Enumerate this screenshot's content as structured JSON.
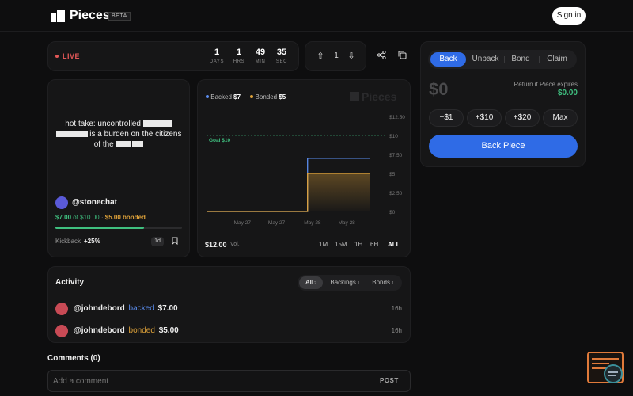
{
  "header": {
    "brand": "Pieces",
    "badge": "BETA",
    "signin_label": "Sign in"
  },
  "status": {
    "live_label": "LIVE",
    "countdown": [
      {
        "value": "1",
        "unit": "DAYS"
      },
      {
        "value": "1",
        "unit": "HRS"
      },
      {
        "value": "49",
        "unit": "MIN"
      },
      {
        "value": "35",
        "unit": "SEC"
      }
    ],
    "vote_count": "1"
  },
  "piece": {
    "text_lines": [
      "hot take: uncontrolled",
      "is a burden on the citizens",
      "of the"
    ],
    "author": "@stonechat",
    "backed": "$7.00",
    "goal_text": "of $10.00",
    "bonded": "$5.00 bonded",
    "progress": 0.7,
    "kickback_label": "Kickback",
    "kickback_value": "+25%",
    "period": "1d"
  },
  "chart_data": {
    "type": "line",
    "legend": [
      {
        "name": "Backed",
        "value": "$7",
        "color": "#5b8def"
      },
      {
        "name": "Bonded",
        "value": "$5",
        "color": "#e0a33a"
      }
    ],
    "x_ticks": [
      "May 27",
      "May 27",
      "May 28",
      "May 28"
    ],
    "y_ticks": [
      "$12.50",
      "$10",
      "$7.50",
      "$5",
      "$2.50",
      "$0"
    ],
    "ylim": [
      0,
      12.5
    ],
    "goal_label": "Goal $10",
    "goal_value": 10,
    "series": [
      {
        "name": "Backed",
        "x": [
          0,
          0.62,
          0.62,
          1
        ],
        "y": [
          0,
          0,
          7,
          7
        ]
      },
      {
        "name": "Bonded",
        "x": [
          0,
          0.62,
          0.62,
          1
        ],
        "y": [
          0,
          0,
          5,
          5
        ]
      }
    ],
    "volume": "$12.00",
    "volume_label": "Vol.",
    "timeframes": [
      "1M",
      "15M",
      "1H",
      "6H",
      "ALL"
    ],
    "active_timeframe": "ALL",
    "watermark": "Pieces"
  },
  "trade": {
    "tabs": [
      "Back",
      "Unback",
      "Bond",
      "Claim"
    ],
    "active_tab": "Back",
    "amount": "$0",
    "return_label": "Return if Piece expires",
    "return_value": "$0.00",
    "quick_amounts": [
      "+$1",
      "+$10",
      "+$20",
      "Max"
    ],
    "submit_label": "Back Piece"
  },
  "activity": {
    "title": "Activity",
    "tabs": [
      {
        "label": "All",
        "count": "2"
      },
      {
        "label": "Backings",
        "count": "1"
      },
      {
        "label": "Bonds",
        "count": "1"
      }
    ],
    "rows": [
      {
        "user": "@johndebord",
        "action": "backed",
        "amount": "$7.00",
        "time": "16h",
        "action_color": "#5b8def"
      },
      {
        "user": "@johndebord",
        "action": "bonded",
        "amount": "$5.00",
        "time": "16h",
        "action_color": "#e0a33a"
      }
    ]
  },
  "comments": {
    "title": "Comments (0)",
    "placeholder": "Add a comment",
    "post_label": "POST"
  }
}
